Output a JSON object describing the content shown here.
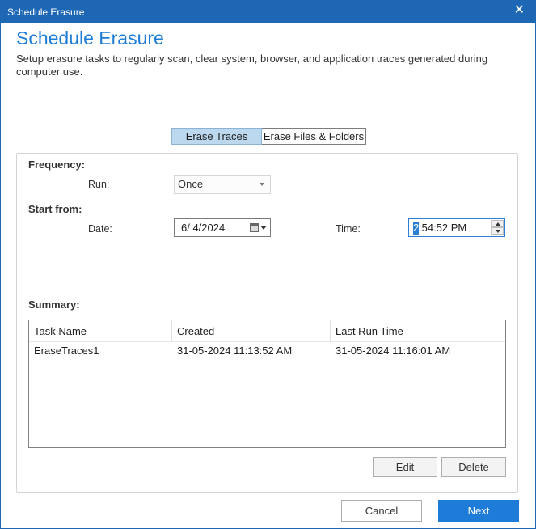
{
  "window": {
    "title": "Schedule Erasure",
    "close_glyph": "✕"
  },
  "header": {
    "heading": "Schedule Erasure",
    "subtitle": "Setup erasure tasks to regularly scan, clear system, browser, and application traces generated during computer use."
  },
  "tabs": [
    {
      "label": "Erase Traces",
      "active": true
    },
    {
      "label": "Erase Files & Folders",
      "active": false
    }
  ],
  "frequency": {
    "label": "Frequency:",
    "run_label": "Run:",
    "run_value": "Once"
  },
  "start_from": {
    "label": "Start from:",
    "date_label": "Date:",
    "date_value": "6/  4/2024",
    "time_label": "Time:",
    "time_selected": "2",
    "time_rest": ":54:52 PM"
  },
  "summary": {
    "label": "Summary:",
    "columns": [
      "Task Name",
      "Created",
      "Last Run Time"
    ],
    "rows": [
      [
        "EraseTraces1",
        "31-05-2024 11:13:52 AM",
        "31-05-2024 11:16:01 AM"
      ]
    ]
  },
  "buttons": {
    "edit": "Edit",
    "delete": "Delete",
    "cancel": "Cancel",
    "next": "Next"
  },
  "colors": {
    "accent": "#1e7cd8",
    "titlebar": "#1e67b4",
    "tab_active": "#bcd8ef"
  }
}
